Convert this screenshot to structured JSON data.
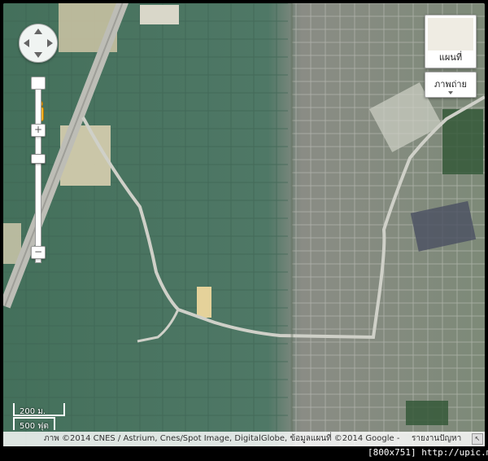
{
  "map": {
    "type": "satellite",
    "controls": {
      "pan_icon": "pan-arrows-icon",
      "zoom_in_label": "+",
      "zoom_out_label": "−",
      "pegman_icon": "street-view-pegman-icon"
    },
    "map_type_buttons": {
      "map_label": "แผนที่",
      "satellite_label": "ภาพถ่าย"
    },
    "scale": {
      "metric_label": "200 ม.",
      "imperial_label": "500 ฟุต"
    },
    "attribution": {
      "text": "ภาพ ©2014 CNES / Astrium, Cnes/Spot Image, DigitalGlobe, ข้อมูลแผนที่ ©2014 Google -",
      "report_link": "รายงานปัญหา"
    },
    "colors": {
      "fields_green": "#4d7562",
      "fields_brown": "#8a8a80",
      "road": "#c9c9c2"
    }
  },
  "watermark": "[800x751] http://upic.me/"
}
